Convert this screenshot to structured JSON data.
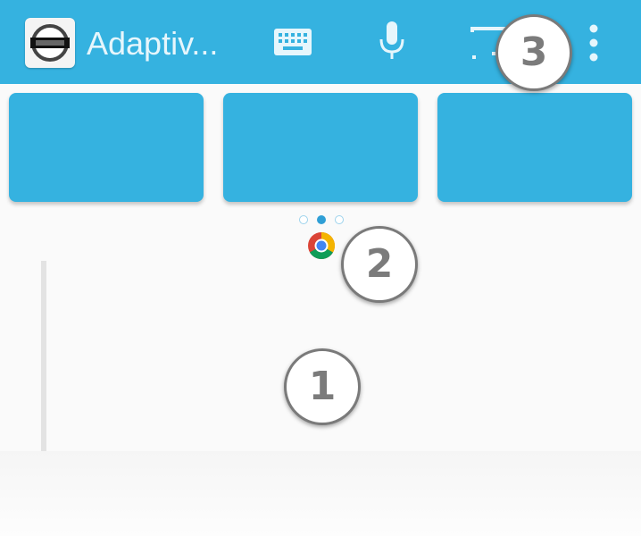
{
  "app_bar": {
    "title": "Adaptiv...",
    "app_icon": "app-logo-icon",
    "actions": [
      {
        "icon": "keyboard-icon"
      },
      {
        "icon": "microphone-icon"
      },
      {
        "icon": "cast-icon"
      },
      {
        "icon": "more-vert-icon"
      }
    ],
    "color": "#35b2e0"
  },
  "tiles": [
    {
      "color": "#35b2e0"
    },
    {
      "color": "#35b2e0"
    },
    {
      "color": "#35b2e0"
    }
  ],
  "page_indicator": {
    "count": 3,
    "active_index": 1
  },
  "shortcut": {
    "icon": "chrome-icon"
  },
  "callouts": [
    {
      "number": "1"
    },
    {
      "number": "2"
    },
    {
      "number": "3"
    }
  ]
}
